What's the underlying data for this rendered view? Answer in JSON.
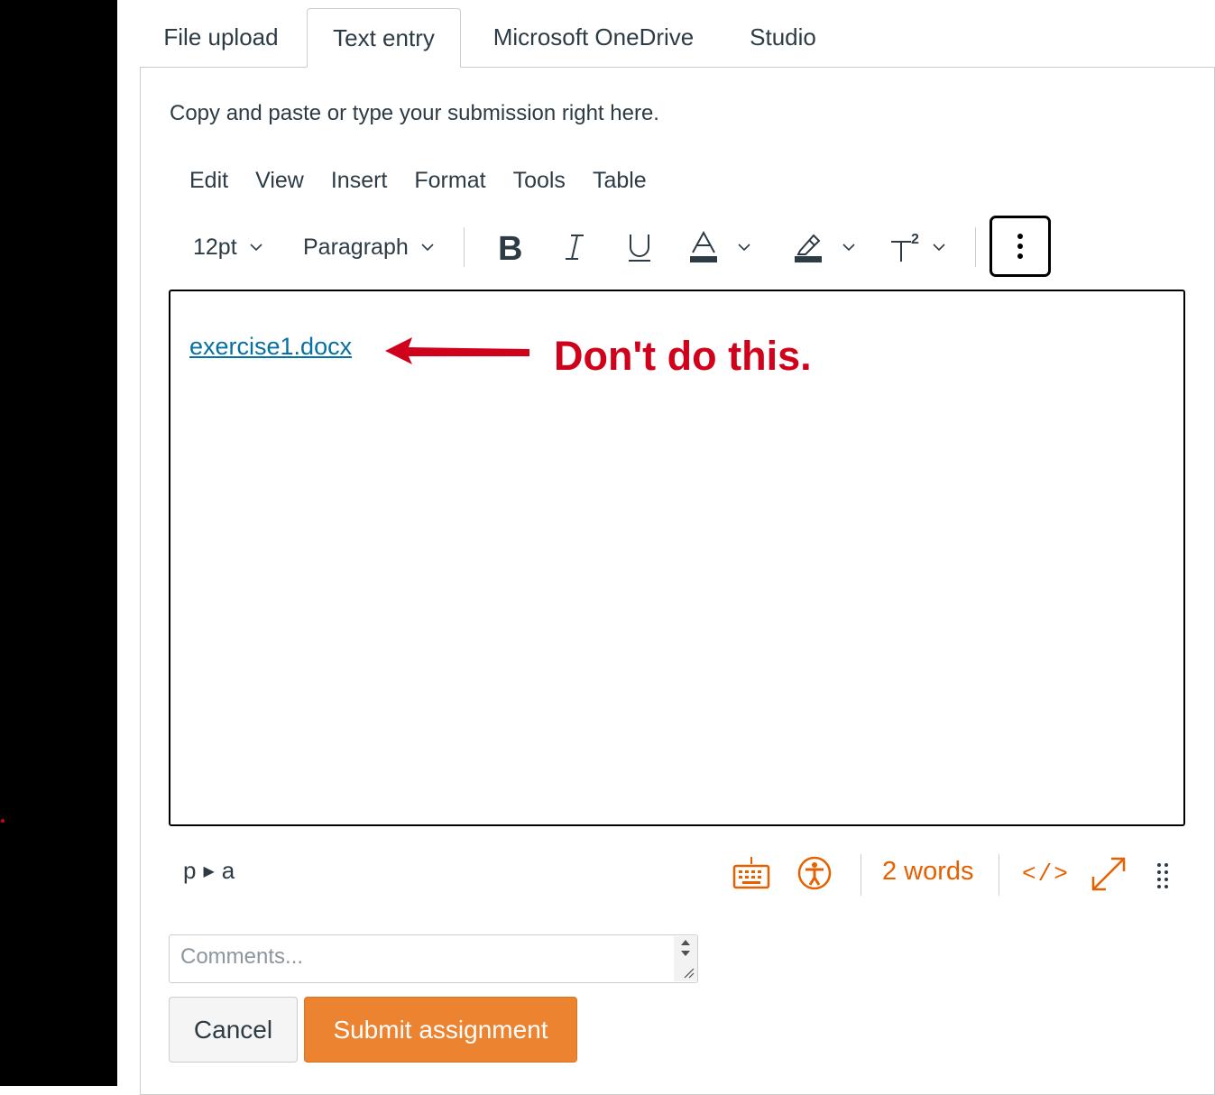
{
  "tabs": [
    {
      "label": "File upload",
      "active": false
    },
    {
      "label": "Text entry",
      "active": true
    },
    {
      "label": "Microsoft OneDrive",
      "active": false
    },
    {
      "label": "Studio",
      "active": false
    }
  ],
  "instructions": "Copy and paste or type your submission right here.",
  "menubar": [
    "Edit",
    "View",
    "Insert",
    "Format",
    "Tools",
    "Table"
  ],
  "toolbar": {
    "font_size": "12pt",
    "block_format": "Paragraph",
    "buttons": [
      "bold-icon",
      "italic-icon",
      "underline-icon",
      "text-color-icon",
      "highlight-color-icon",
      "superscript-icon",
      "more-vertical-icon"
    ]
  },
  "editor": {
    "link_text": "exercise1.docx",
    "annotation": "Don't do this."
  },
  "statusbar": {
    "path_p": "p",
    "path_a": "a",
    "word_count": "2 words",
    "html_toggle": "</>",
    "icons": [
      "keyboard-icon",
      "accessibility-icon",
      "fullscreen-icon",
      "resize-handle-icon"
    ]
  },
  "comments": {
    "placeholder": "Comments...",
    "value": ""
  },
  "buttons": {
    "cancel": "Cancel",
    "submit": "Submit assignment"
  },
  "colors": {
    "accent": "#ec8330",
    "status_icons": "#e66000",
    "link": "#0770a3",
    "annotation": "#d0021b",
    "text": "#2d3b45"
  }
}
